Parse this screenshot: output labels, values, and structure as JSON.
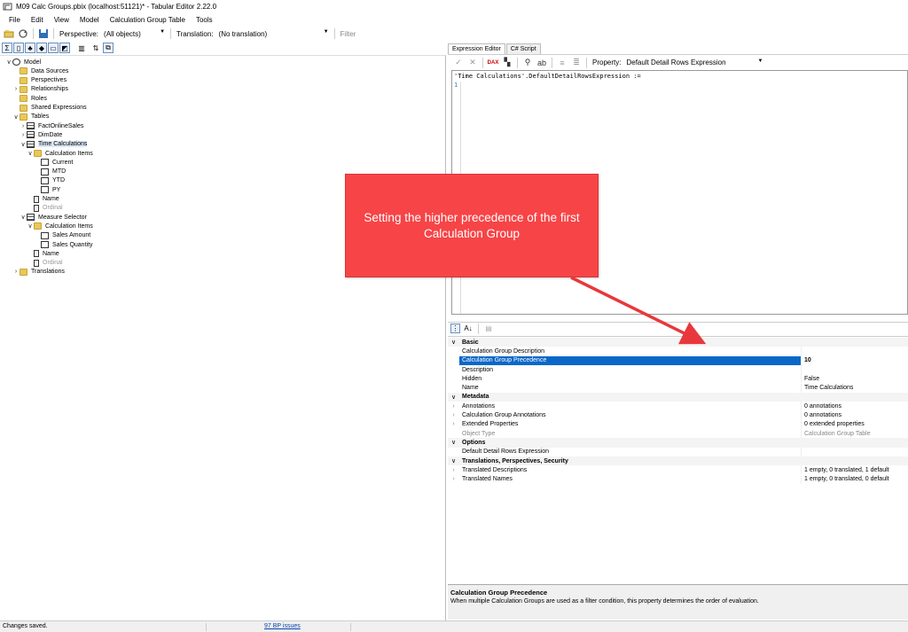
{
  "window": {
    "title": "M09 Calc Groups.pbix (localhost:51121)* - Tabular Editor 2.22.0"
  },
  "menu": [
    "File",
    "Edit",
    "View",
    "Model",
    "Calculation Group Table",
    "Tools"
  ],
  "toolbar": {
    "perspective_label": "Perspective:",
    "perspective_value": "(All objects)",
    "translation_label": "Translation:",
    "translation_value": "(No translation)",
    "filter_placeholder": "Filter"
  },
  "tree": [
    {
      "label": "Model",
      "indent": 0,
      "expander": "∨",
      "icon": "model-icon",
      "style": "normal"
    },
    {
      "label": "Data Sources",
      "indent": 1,
      "expander": "",
      "icon": "folder-icon",
      "style": "normal"
    },
    {
      "label": "Perspectives",
      "indent": 1,
      "expander": "",
      "icon": "folder-icon",
      "style": "normal"
    },
    {
      "label": "Relationships",
      "indent": 1,
      "expander": "›",
      "icon": "folder-icon",
      "style": "normal"
    },
    {
      "label": "Roles",
      "indent": 1,
      "expander": "",
      "icon": "folder-icon",
      "style": "normal"
    },
    {
      "label": "Shared Expressions",
      "indent": 1,
      "expander": "",
      "icon": "folder-icon",
      "style": "normal"
    },
    {
      "label": "Tables",
      "indent": 1,
      "expander": "∨",
      "icon": "folder-icon",
      "style": "normal"
    },
    {
      "label": "FactOnlineSales",
      "indent": 2,
      "expander": "›",
      "icon": "table-icon",
      "style": "normal"
    },
    {
      "label": "DimDate",
      "indent": 2,
      "expander": "›",
      "icon": "table-icon",
      "style": "normal"
    },
    {
      "label": "Time Calculations",
      "indent": 2,
      "expander": "∨",
      "icon": "calc-group-icon",
      "style": "selected"
    },
    {
      "label": "Calculation Items",
      "indent": 3,
      "expander": "∨",
      "icon": "folder-icon",
      "style": "normal"
    },
    {
      "label": "Current",
      "indent": 4,
      "expander": "",
      "icon": "calc-item-icon",
      "style": "normal"
    },
    {
      "label": "MTD",
      "indent": 4,
      "expander": "",
      "icon": "calc-item-icon",
      "style": "normal"
    },
    {
      "label": "YTD",
      "indent": 4,
      "expander": "",
      "icon": "calc-item-icon",
      "style": "normal"
    },
    {
      "label": "PY",
      "indent": 4,
      "expander": "",
      "icon": "calc-item-icon",
      "style": "normal"
    },
    {
      "label": "Name",
      "indent": 3,
      "expander": "",
      "icon": "column-icon",
      "style": "normal"
    },
    {
      "label": "Ordinal",
      "indent": 3,
      "expander": "",
      "icon": "column-icon",
      "style": "grey"
    },
    {
      "label": "Measure Selector",
      "indent": 2,
      "expander": "∨",
      "icon": "calc-group-icon",
      "style": "normal"
    },
    {
      "label": "Calculation Items",
      "indent": 3,
      "expander": "∨",
      "icon": "folder-icon",
      "style": "normal"
    },
    {
      "label": "Sales Amount",
      "indent": 4,
      "expander": "",
      "icon": "calc-item-icon",
      "style": "normal"
    },
    {
      "label": "Sales Quantity",
      "indent": 4,
      "expander": "",
      "icon": "calc-item-icon",
      "style": "normal"
    },
    {
      "label": "Name",
      "indent": 3,
      "expander": "",
      "icon": "column-icon",
      "style": "normal"
    },
    {
      "label": "Ordinal",
      "indent": 3,
      "expander": "",
      "icon": "column-icon",
      "style": "grey"
    },
    {
      "label": "Translations",
      "indent": 1,
      "expander": "›",
      "icon": "folder-icon",
      "style": "normal"
    }
  ],
  "editor": {
    "tabs": [
      "Expression Editor",
      "C# Script"
    ],
    "property_label": "Property:",
    "property_value": "Default Detail Rows Expression",
    "expression_header": "'Time Calculations'.DefaultDetailRowsExpression :=",
    "line_number": "1"
  },
  "properties": [
    {
      "kind": "cat",
      "name": "Basic"
    },
    {
      "kind": "row",
      "name": "Calculation Group Description",
      "value": "",
      "gut": ""
    },
    {
      "kind": "row",
      "name": "Calculation Group Precedence",
      "value": "10",
      "gut": "",
      "selected": true
    },
    {
      "kind": "row",
      "name": "Description",
      "value": "",
      "gut": ""
    },
    {
      "kind": "row",
      "name": "Hidden",
      "value": "False",
      "gut": ""
    },
    {
      "kind": "row",
      "name": "Name",
      "value": "Time Calculations",
      "gut": ""
    },
    {
      "kind": "cat",
      "name": "Metadata"
    },
    {
      "kind": "row",
      "name": "Annotations",
      "value": "0 annotations",
      "gut": "›"
    },
    {
      "kind": "row",
      "name": "Calculation Group Annotations",
      "value": "0 annotations",
      "gut": "›"
    },
    {
      "kind": "row",
      "name": "Extended Properties",
      "value": "0 extended properties",
      "gut": "›"
    },
    {
      "kind": "row",
      "name": "Object Type",
      "value": "Calculation Group Table",
      "gut": "",
      "grey": true
    },
    {
      "kind": "cat",
      "name": "Options"
    },
    {
      "kind": "row",
      "name": "Default Detail Rows Expression",
      "value": "",
      "gut": ""
    },
    {
      "kind": "cat",
      "name": "Translations, Perspectives, Security"
    },
    {
      "kind": "row",
      "name": "Translated Descriptions",
      "value": "1 empty, 0 translated, 1 default",
      "gut": "›"
    },
    {
      "kind": "row",
      "name": "Translated Names",
      "value": "1 empty, 0 translated, 0 default",
      "gut": "›"
    }
  ],
  "description": {
    "title": "Calculation Group Precedence",
    "text": "When multiple Calculation Groups are used as a filter condition, this property determines the order of evaluation."
  },
  "status": {
    "message": "Changes saved.",
    "bp_issues": "97 BP issues"
  },
  "callout": {
    "text": "Setting the higher precedence of the first Calculation Group",
    "color": "#f74447"
  }
}
